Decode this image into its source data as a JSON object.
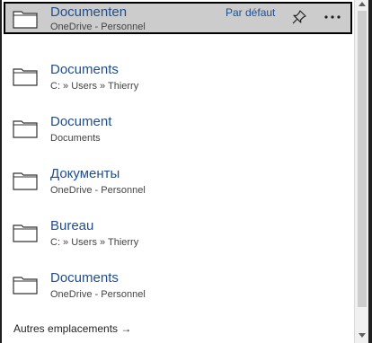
{
  "colors": {
    "accent": "#1f4e8c",
    "selected_bg": "#cccccc",
    "panel_bg": "#ffffff"
  },
  "locations": [
    {
      "title": "Documenten",
      "path": "OneDrive - Personnel",
      "badge": "Par défaut",
      "selected": true,
      "icon": "folder-icon"
    },
    {
      "title": "Documents",
      "path": "C: » Users » Thierry",
      "icon": "folder-icon"
    },
    {
      "title": "Document",
      "path": "Documents",
      "icon": "folder-icon"
    },
    {
      "title": "Документы",
      "path": "OneDrive - Personnel",
      "icon": "folder-icon"
    },
    {
      "title": "Bureau",
      "path": "C: » Users » Thierry",
      "icon": "folder-icon"
    },
    {
      "title": "Documents",
      "path": "OneDrive - Personnel",
      "icon": "folder-icon"
    }
  ],
  "actions": {
    "pin_icon": "pin-icon",
    "more_icon": "more-options-icon"
  },
  "footer": {
    "label": "Autres emplacements →"
  }
}
